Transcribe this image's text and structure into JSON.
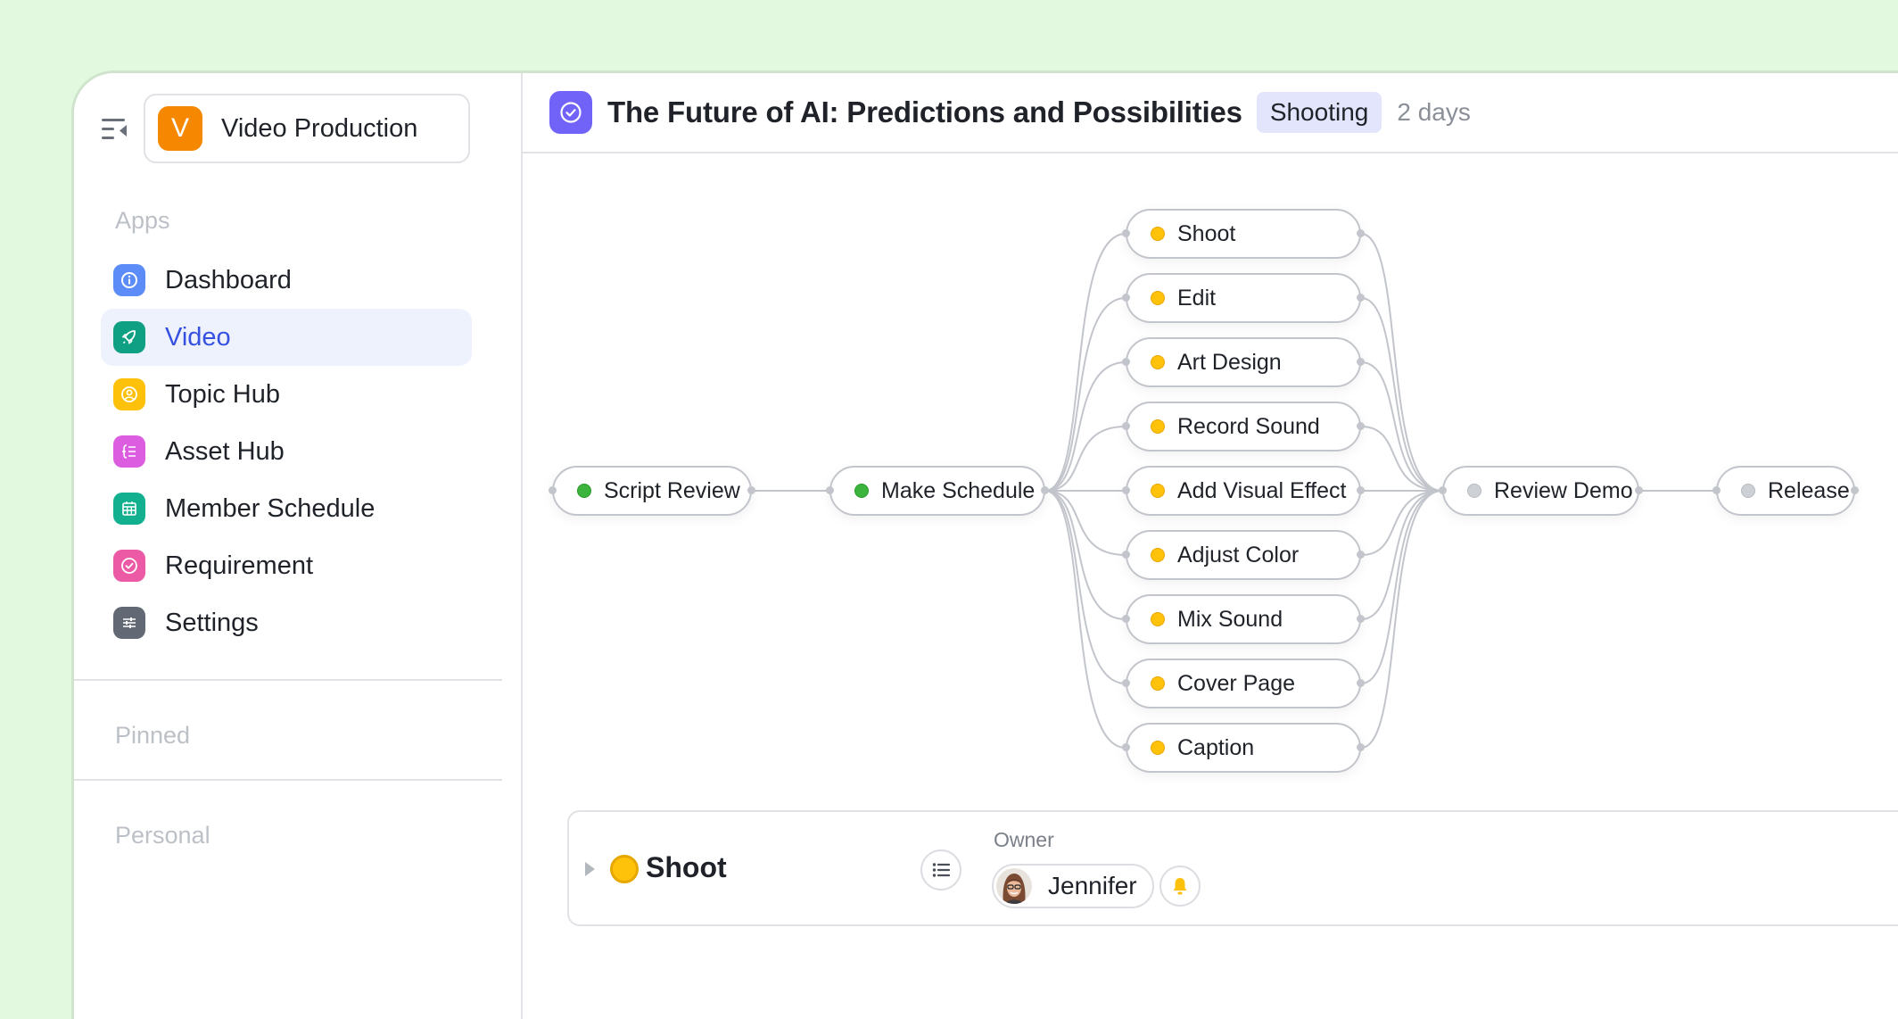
{
  "sidebar": {
    "workspace": {
      "initial": "V",
      "name": "Video Production",
      "color": "#f58800"
    },
    "sections": {
      "apps": "Apps",
      "pinned": "Pinned",
      "personal": "Personal"
    },
    "items": [
      {
        "label": "Dashboard",
        "icon": "info-icon",
        "color": "#5b8cf7",
        "active": false
      },
      {
        "label": "Video",
        "icon": "rocket-icon",
        "color": "#0f9f82",
        "active": true
      },
      {
        "label": "Topic Hub",
        "icon": "user-circle-icon",
        "color": "#fdc10c",
        "active": false
      },
      {
        "label": "Asset Hub",
        "icon": "list-tree-icon",
        "color": "#dc5ddf",
        "active": false
      },
      {
        "label": "Member Schedule",
        "icon": "calendar-grid-icon",
        "color": "#12b08f",
        "active": false
      },
      {
        "label": "Requirement",
        "icon": "check-circle-icon",
        "color": "#ec5aa5",
        "active": false
      },
      {
        "label": "Settings",
        "icon": "sliders-icon",
        "color": "#626874",
        "active": false
      }
    ]
  },
  "header": {
    "title": "The Future of AI: Predictions and Possibilities",
    "status": "Shooting",
    "duration": "2 days",
    "icon_color": "#7163f7"
  },
  "flow": {
    "status_colors": {
      "done": "#3cb33c",
      "in_progress": "#ffc20a",
      "pending": "#cdd0d5"
    },
    "nodes": [
      {
        "id": "script-review",
        "label": "Script Review",
        "status": "done"
      },
      {
        "id": "make-schedule",
        "label": "Make Schedule",
        "status": "done"
      },
      {
        "id": "shoot",
        "label": "Shoot",
        "status": "in_progress"
      },
      {
        "id": "edit",
        "label": "Edit",
        "status": "in_progress"
      },
      {
        "id": "art-design",
        "label": "Art Design",
        "status": "in_progress"
      },
      {
        "id": "record-sound",
        "label": "Record Sound",
        "status": "in_progress"
      },
      {
        "id": "add-visual-effect",
        "label": "Add Visual Effect",
        "status": "in_progress"
      },
      {
        "id": "adjust-color",
        "label": "Adjust Color",
        "status": "in_progress"
      },
      {
        "id": "mix-sound",
        "label": "Mix Sound",
        "status": "in_progress"
      },
      {
        "id": "cover-page",
        "label": "Cover Page",
        "status": "in_progress"
      },
      {
        "id": "caption",
        "label": "Caption",
        "status": "in_progress"
      },
      {
        "id": "review-demo",
        "label": "Review Demo",
        "status": "pending"
      },
      {
        "id": "release",
        "label": "Release",
        "status": "pending"
      }
    ],
    "edges": [
      [
        "script-review",
        "make-schedule"
      ],
      [
        "make-schedule",
        "shoot"
      ],
      [
        "make-schedule",
        "edit"
      ],
      [
        "make-schedule",
        "art-design"
      ],
      [
        "make-schedule",
        "record-sound"
      ],
      [
        "make-schedule",
        "add-visual-effect"
      ],
      [
        "make-schedule",
        "adjust-color"
      ],
      [
        "make-schedule",
        "mix-sound"
      ],
      [
        "make-schedule",
        "cover-page"
      ],
      [
        "make-schedule",
        "caption"
      ],
      [
        "shoot",
        "review-demo"
      ],
      [
        "edit",
        "review-demo"
      ],
      [
        "art-design",
        "review-demo"
      ],
      [
        "record-sound",
        "review-demo"
      ],
      [
        "add-visual-effect",
        "review-demo"
      ],
      [
        "adjust-color",
        "review-demo"
      ],
      [
        "mix-sound",
        "review-demo"
      ],
      [
        "cover-page",
        "review-demo"
      ],
      [
        "caption",
        "review-demo"
      ],
      [
        "review-demo",
        "release"
      ]
    ]
  },
  "detail": {
    "task": "Shoot",
    "task_status": "in_progress",
    "owner_label": "Owner",
    "owner_name": "Jennifer"
  }
}
